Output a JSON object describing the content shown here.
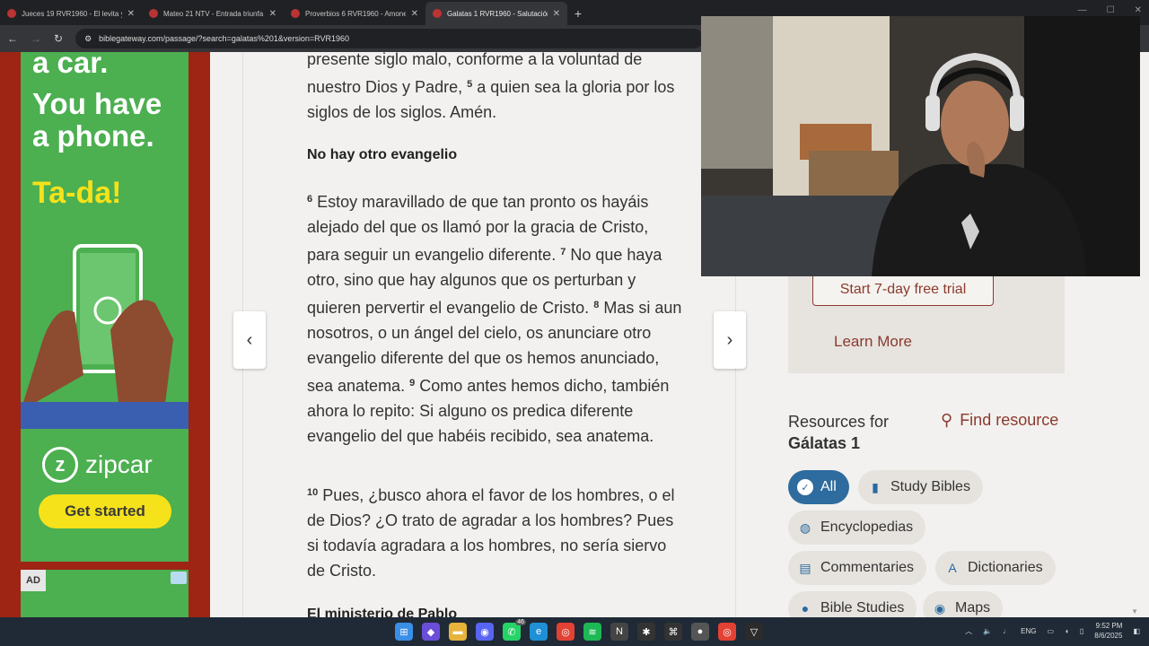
{
  "tabs": [
    {
      "title": "Jueces 19 RVR1960 - El levita y",
      "active": false
    },
    {
      "title": "Mateo 21 NTV - Entrada triunfa",
      "active": false
    },
    {
      "title": "Proverbios 6 RVR1960 - Amone",
      "active": false
    },
    {
      "title": "Galatas 1 RVR1960 - Salutación",
      "active": true
    }
  ],
  "address": {
    "url": "biblegateway.com/passage/?search=galatas%201&version=RVR1960"
  },
  "ad": {
    "line1": "a car.",
    "line2": "You have",
    "line3": "a phone.",
    "tada": "Ta-da!",
    "brand": "zipcar",
    "cta": "Get started",
    "ad_label": "AD"
  },
  "passage": {
    "intro_lines": "presente siglo malo, conforme a la voluntad de nuestro Dios y Padre,",
    "v5_num": "5",
    "v5_text": "a quien sea la gloria por los siglos de los siglos. Amén.",
    "heading1": "No hay otro evangelio",
    "v6_num": "6",
    "v6_text": "Estoy maravillado de que tan pronto os hayáis alejado del que os llamó por la gracia de Cristo, para seguir un evangelio diferente.",
    "v7_num": "7",
    "v7_text": "No que haya otro, sino que hay algunos que os perturban y quieren pervertir el evangelio de Cristo.",
    "v8_num": "8",
    "v8_text": "Mas si aun nosotros, o un ángel del cielo, os anunciare otro evangelio diferente del que os hemos anunciado, sea anatema.",
    "v9_num": "9",
    "v9_text": "Como antes hemos dicho, también ahora lo repito: Si alguno os predica diferente evangelio del que habéis recibido, sea anatema.",
    "v10_num": "10",
    "v10_text": "Pues, ¿busco ahora el favor de los hombres, o el de Dios? ¿O trato de agradar a los hombres? Pues si todavía agradara a los hombres, no sería siervo de Cristo.",
    "heading2": "El ministerio de Pablo"
  },
  "sidebar": {
    "trial_label": "Start 7-day free trial",
    "learn_more": "Learn More",
    "resources_for": "Resources for",
    "book": "Gálatas 1",
    "find_resource": "Find resource",
    "chips": {
      "all": "All",
      "study_bibles": "Study Bibles",
      "encyclopedias": "Encyclopedias",
      "commentaries": "Commentaries",
      "dictionaries": "Dictionaries",
      "bible_studies": "Bible Studies",
      "maps": "Maps"
    }
  },
  "taskbar": {
    "lang": "ENG",
    "time": "9:52 PM",
    "date": "8/6/2025",
    "badge": "46"
  },
  "colors": {
    "accent": "#8b3a2e",
    "chip_active": "#2e6b9e",
    "ad_green": "#4caf50",
    "ad_yellow": "#f5e21b",
    "side_red": "#9e2414"
  }
}
